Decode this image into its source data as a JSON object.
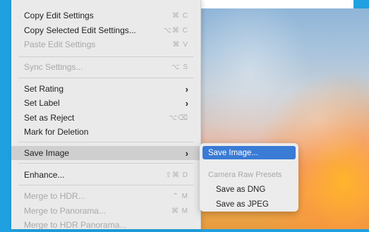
{
  "menu": {
    "items": [
      {
        "label": "Copy Edit Settings",
        "shortcut": "⌘ C",
        "disabled": false
      },
      {
        "label": "Copy Selected Edit Settings...",
        "shortcut": "⌥⌘ C",
        "disabled": false
      },
      {
        "label": "Paste Edit Settings",
        "shortcut": "⌘ V",
        "disabled": true
      },
      {
        "label": "Sync Settings...",
        "shortcut": "⌥ S",
        "disabled": true
      },
      {
        "label": "Set Rating",
        "chevron": "›",
        "disabled": false
      },
      {
        "label": "Set Label",
        "chevron": "›",
        "disabled": false
      },
      {
        "label": "Set as Reject",
        "shortcut": "⌥⌫",
        "disabled": false
      },
      {
        "label": "Mark for Deletion",
        "disabled": false
      },
      {
        "label": "Save Image",
        "chevron": "›",
        "disabled": false,
        "highlighted": true
      },
      {
        "label": "Enhance...",
        "shortcut": "⇧⌘ D",
        "disabled": false
      },
      {
        "label": "Merge to HDR...",
        "shortcut": "⌃ M",
        "disabled": true
      },
      {
        "label": "Merge to Panorama...",
        "shortcut": "⌘ M",
        "disabled": true
      },
      {
        "label": "Merge to HDR Panorama...",
        "disabled": true
      }
    ]
  },
  "submenu": {
    "save_image": "Save Image...",
    "header": "Camera Raw Presets",
    "save_dng": "Save as DNG",
    "save_jpeg": "Save as JPEG"
  }
}
